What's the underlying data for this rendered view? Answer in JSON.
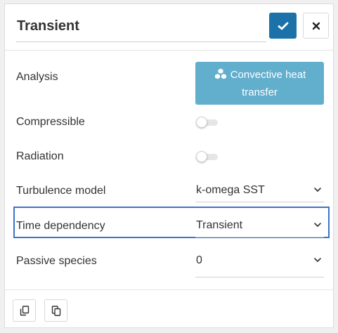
{
  "header": {
    "title": "Transient",
    "confirm_icon": "check-icon",
    "close_icon": "close-icon"
  },
  "rows": {
    "analysis": {
      "label": "Analysis",
      "button_label": "Convective heat transfer",
      "icon": "cubes-icon"
    },
    "compressible": {
      "label": "Compressible",
      "enabled": false
    },
    "radiation": {
      "label": "Radiation",
      "enabled": false
    },
    "turbulence": {
      "label": "Turbulence model",
      "value": "k-omega SST"
    },
    "time_dependency": {
      "label": "Time dependency",
      "value": "Transient"
    },
    "passive_species": {
      "label": "Passive species",
      "value": "0"
    }
  },
  "footer": {
    "buttons": [
      "copy-icon",
      "paste-icon"
    ]
  },
  "colors": {
    "confirm": "#1a72a9",
    "analysis_button": "#61aecd",
    "highlight": "#3b74c6"
  }
}
